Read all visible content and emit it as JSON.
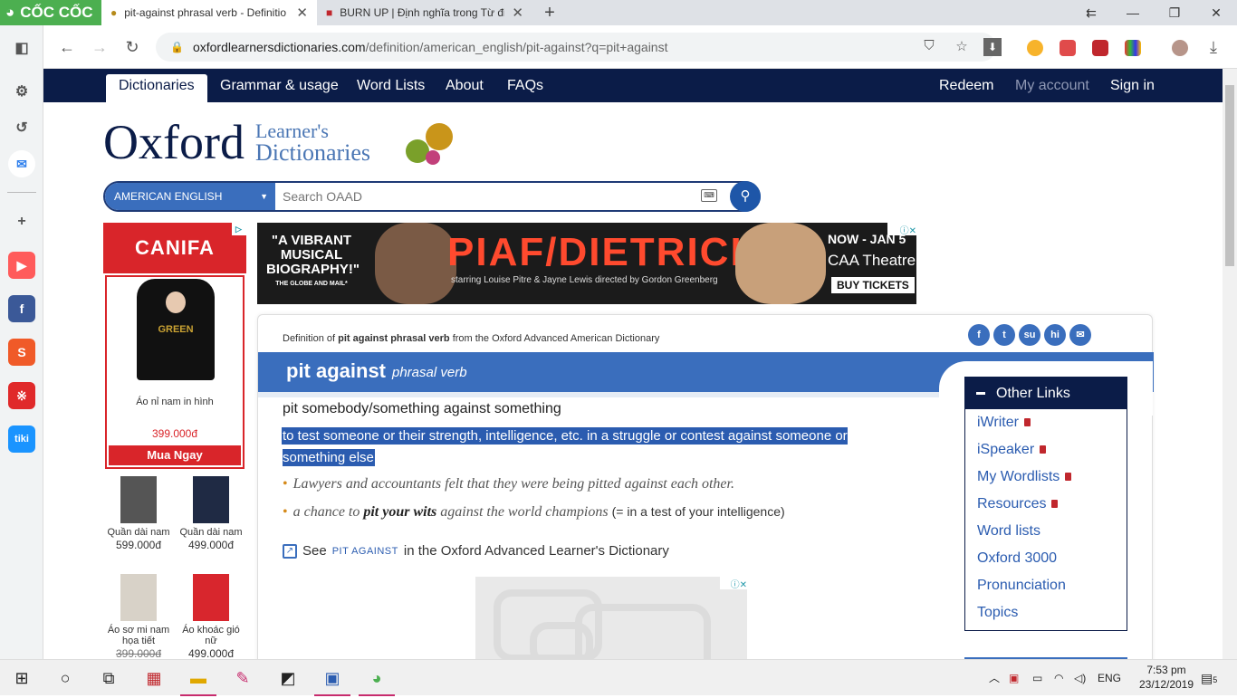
{
  "browser": {
    "logo_text": "CỐC CỐC",
    "tabs": [
      {
        "title": "pit-against phrasal verb - Definitio",
        "active": true
      },
      {
        "title": "BURN UP | Định nghĩa trong Từ điể",
        "active": false
      }
    ],
    "url_domain": "oxfordlearnersdictionaries.com",
    "url_path": "/definition/american_english/pit-against?q=pit+against"
  },
  "site_nav": {
    "items": [
      "Dictionaries",
      "Grammar & usage",
      "Word Lists",
      "About",
      "FAQs"
    ],
    "right": [
      "Redeem",
      "My account",
      "Sign in"
    ]
  },
  "brand": {
    "name": "Oxford",
    "sub1": "Learner's",
    "sub2": "Dictionaries"
  },
  "search": {
    "dictionary": "AMERICAN ENGLISH",
    "placeholder": "Search OAAD"
  },
  "left_ad": {
    "brand": "CANIFA",
    "featured": {
      "name": "Áo nỉ nam in hình",
      "price": "399.000đ",
      "cta": "Mua Ngay",
      "print": "GREEN"
    },
    "items": [
      {
        "name": "Quần dài nam",
        "price": "599.000đ",
        "old": ""
      },
      {
        "name": "Quần dài nam",
        "price": "499.000đ",
        "old": ""
      },
      {
        "name": "Áo sơ mi nam họa tiết",
        "price": "",
        "old": "399.000đ"
      },
      {
        "name": "Áo khoác gió nữ",
        "price": "499.000đ",
        "old": ""
      }
    ]
  },
  "banner_ad": {
    "quote": "\"A VIBRANT MUSICAL BIOGRAPHY!\"",
    "quote_src": "THE GLOBE AND MAIL*",
    "title": "PIAF/DIETRICH",
    "credits": "starring Louise Pitre & Jayne Lewis  directed by Gordon Greenberg",
    "dates": "NOW - JAN 5",
    "venue": "CAA Theatre",
    "cta": "BUY TICKETS"
  },
  "entry": {
    "source_prefix": "Definition of ",
    "source_term": "pit against phrasal verb",
    "source_suffix": " from the Oxford Advanced American Dictionary",
    "headword": "pit against",
    "pos": "phrasal verb",
    "pattern": "pit somebody/something against something",
    "definition": "to test someone or their strength, intelligence, etc. in a struggle or contest against someone or something else",
    "examples": [
      {
        "pre": "Lawyers and accountants felt that they were being pitted against each other.",
        "bold": "",
        "post": "",
        "gloss": ""
      },
      {
        "pre": "a chance to ",
        "bold": "pit your wits",
        "post": " against the world champions",
        "gloss": "(= in a test of your intelligence)"
      }
    ],
    "see_label": "See",
    "see_term": "PIT AGAINST",
    "see_rest": "in the Oxford Advanced Learner's Dictionary"
  },
  "share_icons": [
    "facebook-icon",
    "twitter-icon",
    "stumbleupon-icon",
    "hi-icon",
    "email-icon"
  ],
  "other_links": {
    "title": "Other Links",
    "items": [
      {
        "label": "iWriter",
        "locked": true
      },
      {
        "label": "iSpeaker",
        "locked": true
      },
      {
        "label": "My Wordlists",
        "locked": true
      },
      {
        "label": "Resources",
        "locked": true
      },
      {
        "label": "Word lists",
        "locked": false
      },
      {
        "label": "Oxford 3000",
        "locked": false
      },
      {
        "label": "Pronunciation",
        "locked": false
      },
      {
        "label": "Topics",
        "locked": false
      }
    ]
  },
  "taskbar": {
    "lang": "ENG",
    "time": "7:53 pm",
    "date": "23/12/2019",
    "notifications": "5"
  },
  "colors": {
    "oxford_navy": "#0b1c48",
    "oxford_blue": "#3a6ebd",
    "selection": "#2b5cb0",
    "coccoc_green": "#4caf50"
  }
}
